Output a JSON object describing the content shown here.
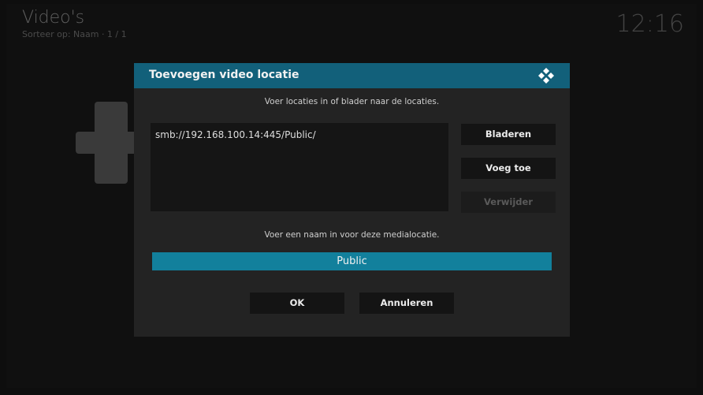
{
  "header": {
    "title": "Video's",
    "sort_info": "Sorteer op: Naam  ·  1 / 1",
    "clock": "12:16"
  },
  "background_icon": "plus-icon",
  "dialog": {
    "title": "Toevoegen video locatie",
    "logo_icon": "kodi-logo-icon",
    "instruction_paths": "Voer locaties in of blader naar de locaties.",
    "paths": [
      "smb://192.168.100.14:445/Public/"
    ],
    "buttons": {
      "browse": "Bladeren",
      "add": "Voeg toe",
      "remove": "Verwijder"
    },
    "instruction_name": "Voer een naam in voor deze medialocatie.",
    "name_value": "Public",
    "ok": "OK",
    "cancel": "Annuleren"
  },
  "colors": {
    "header_bar": "#12607a",
    "name_field": "#12809c",
    "dialog_bg": "#232323",
    "disabled_text": "#5a5a5a"
  }
}
